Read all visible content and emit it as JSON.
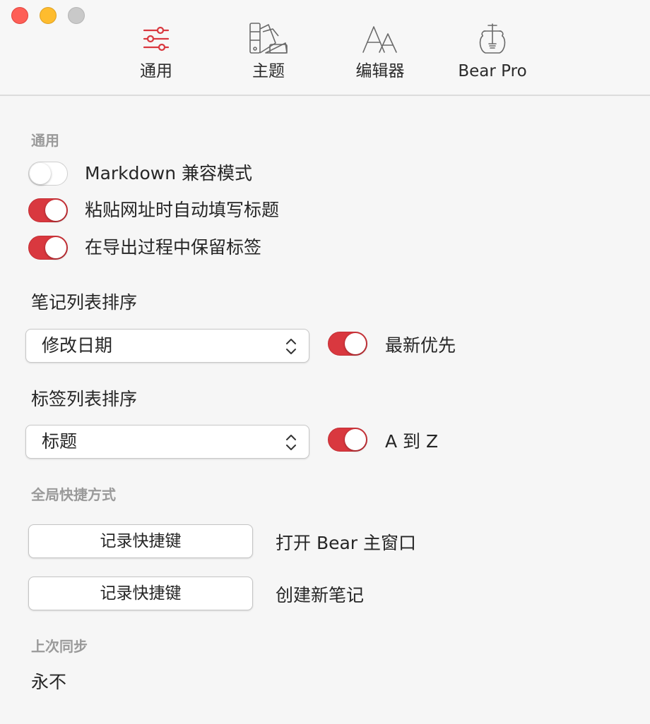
{
  "window": {
    "traffic_lights": [
      "close",
      "minimize",
      "zoom"
    ]
  },
  "tabs": [
    {
      "label": "通用",
      "icon": "sliders-icon",
      "active": true
    },
    {
      "label": "主题",
      "icon": "swatches-icon",
      "active": false
    },
    {
      "label": "编辑器",
      "icon": "font-icon",
      "active": false
    },
    {
      "label": "Bear Pro",
      "icon": "honey-jar-icon",
      "active": false
    }
  ],
  "general": {
    "section_label": "通用",
    "options": [
      {
        "label": "Markdown 兼容模式",
        "enabled": false
      },
      {
        "label": "粘贴网址时自动填写标题",
        "enabled": true
      },
      {
        "label": "在导出过程中保留标签",
        "enabled": true
      }
    ]
  },
  "note_sort": {
    "heading": "笔记列表排序",
    "selected": "修改日期",
    "toggle_label": "最新优先",
    "toggle_enabled": true
  },
  "tag_sort": {
    "heading": "标签列表排序",
    "selected": "标题",
    "toggle_label": "A 到 Z",
    "toggle_enabled": true
  },
  "shortcuts": {
    "section_label": "全局快捷方式",
    "items": [
      {
        "button_label": "记录快捷键",
        "description": "打开 Bear 主窗口"
      },
      {
        "button_label": "记录快捷键",
        "description": "创建新笔记"
      }
    ]
  },
  "sync": {
    "section_label": "上次同步",
    "value": "永不"
  },
  "colors": {
    "accent": "#d9383f",
    "section_label": "#9a9a9a",
    "background": "#f6f6f6"
  }
}
